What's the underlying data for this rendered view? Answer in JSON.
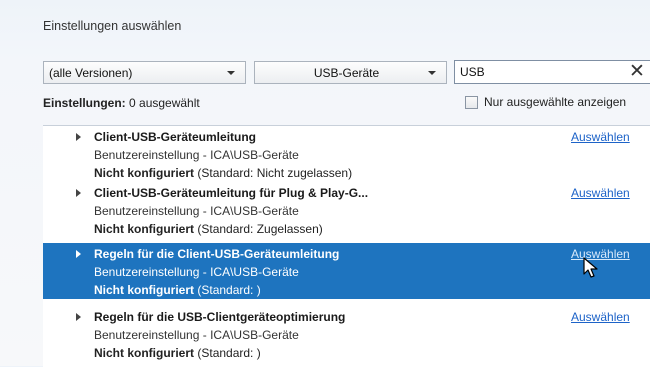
{
  "header": {
    "title": "Einstellungen auswählen"
  },
  "filters": {
    "version": "(alle Versionen)",
    "category": "USB-Geräte",
    "search_value": "USB",
    "clear_icon": "close-icon"
  },
  "summary": {
    "label": "Einstellungen:",
    "value": "0 ausgewählt",
    "show_selected_only": "Nur ausgewählte anzeigen",
    "show_selected_only_checked": false
  },
  "settings": [
    {
      "title": "Client-USB-Geräteumleitung",
      "path": "Benutzereinstellung - ICA\\USB-Geräte",
      "status": "Nicht konfiguriert",
      "default": "(Standard: Nicht zugelassen)",
      "action": "Auswählen",
      "selected": false
    },
    {
      "title": "Client-USB-Geräteumleitung für Plug & Play-G...",
      "path": "Benutzereinstellung - ICA\\USB-Geräte",
      "status": "Nicht konfiguriert",
      "default": "(Standard: Zugelassen)",
      "action": "Auswählen",
      "selected": false
    },
    {
      "title": "Regeln für die Client-USB-Geräteumleitung",
      "path": "Benutzereinstellung - ICA\\USB-Geräte",
      "status": "Nicht konfiguriert",
      "default": "(Standard: )",
      "action": "Auswählen",
      "selected": true
    },
    {
      "title": "Regeln für die USB-Clientgeräteoptimierung",
      "path": "Benutzereinstellung - ICA\\USB-Geräte",
      "status": "Nicht konfiguriert",
      "default": "(Standard: )",
      "action": "Auswählen",
      "selected": false
    }
  ]
}
